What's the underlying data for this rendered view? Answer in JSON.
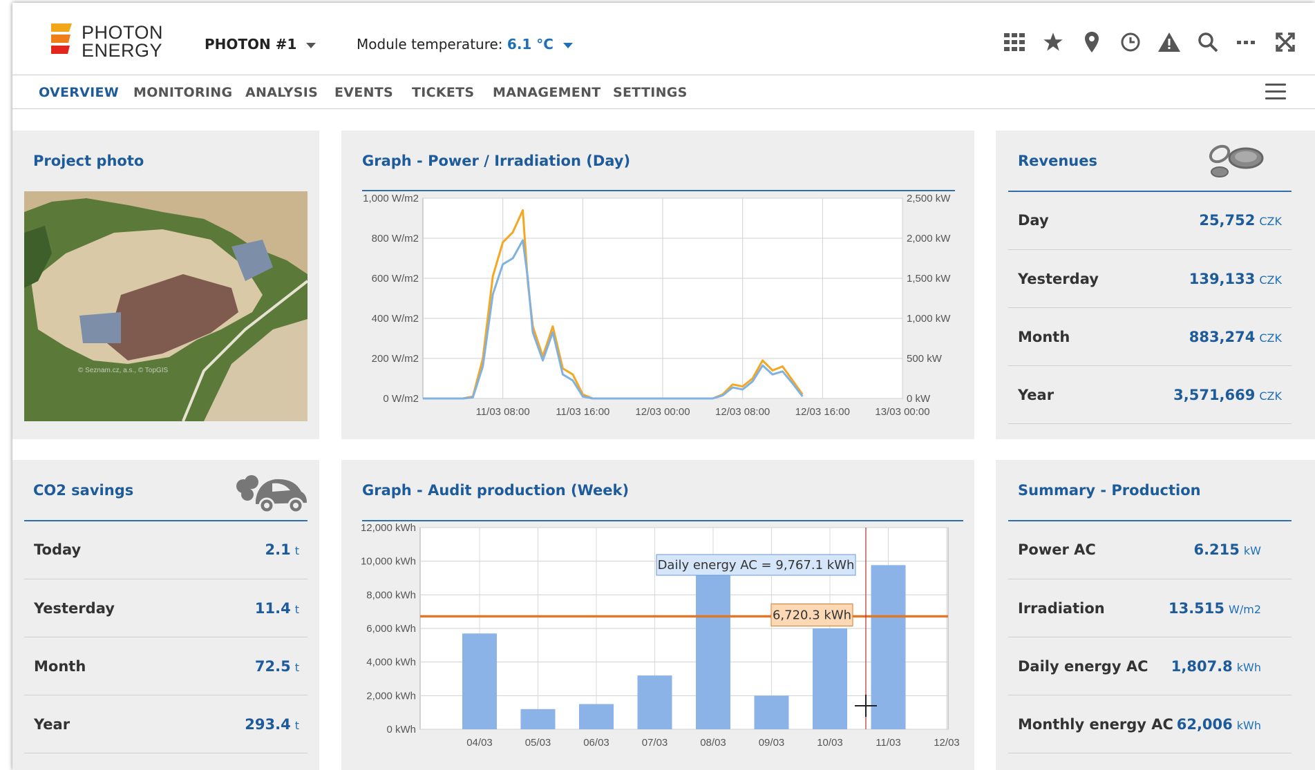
{
  "header": {
    "logo_line1": "PHOTON",
    "logo_line2": "ENERGY",
    "plant_selector": "PHOTON #1",
    "temperature_label": "Module temperature:",
    "temperature_value": "6.1 °C",
    "icons": [
      "grid-icon",
      "star-icon",
      "map-pin-icon",
      "clock-icon",
      "alert-icon",
      "search-icon",
      "more-icon",
      "fullscreen-icon"
    ]
  },
  "nav": {
    "tabs": [
      "OVERVIEW",
      "MONITORING",
      "ANALYSIS",
      "EVENTS",
      "TICKETS",
      "MANAGEMENT",
      "SETTINGS"
    ],
    "active": "OVERVIEW"
  },
  "project_photo": {
    "title": "Project photo",
    "watermark": "© Seznam.cz, a.s., © TopGIS"
  },
  "power_graph": {
    "title": "Graph - Power / Irradiation (Day)"
  },
  "revenues": {
    "title": "Revenues",
    "rows": [
      {
        "label": "Day",
        "value": "25,752",
        "unit": "CZK"
      },
      {
        "label": "Yesterday",
        "value": "139,133",
        "unit": "CZK"
      },
      {
        "label": "Month",
        "value": "883,274",
        "unit": "CZK"
      },
      {
        "label": "Year",
        "value": "3,571,669",
        "unit": "CZK"
      }
    ]
  },
  "co2": {
    "title": "CO2 savings",
    "rows": [
      {
        "label": "Today",
        "value": "2.1",
        "unit": "t"
      },
      {
        "label": "Yesterday",
        "value": "11.4",
        "unit": "t"
      },
      {
        "label": "Month",
        "value": "72.5",
        "unit": "t"
      },
      {
        "label": "Year",
        "value": "293.4",
        "unit": "t"
      }
    ]
  },
  "audit_graph": {
    "title": "Graph - Audit production (Week)",
    "tooltip": "Daily energy AC = 9,767.1 kWh",
    "line_label": "6,720.3 kWh"
  },
  "summary": {
    "title": "Summary - Production",
    "rows": [
      {
        "label": "Power AC",
        "value": "6.215",
        "unit": "kW"
      },
      {
        "label": "Irradiation",
        "value": "13.515",
        "unit": "W/m2"
      },
      {
        "label": "Daily energy AC",
        "value": "1,807.8",
        "unit": "kWh"
      },
      {
        "label": "Monthly energy AC",
        "value": "62,006",
        "unit": "kWh"
      }
    ]
  },
  "chart_data": [
    {
      "type": "line",
      "title": "Graph - Power / Irradiation (Day)",
      "x_ticks": [
        "11/03 08:00",
        "11/03 16:00",
        "12/03 00:00",
        "12/03 08:00",
        "12/03 16:00",
        "13/03 00:00"
      ],
      "y_left_ticks": [
        "0 W/m2",
        "200 W/m2",
        "400 W/m2",
        "600 W/m2",
        "800 W/m2",
        "1,000 W/m2"
      ],
      "y_right_ticks": [
        "0 kW",
        "500 kW",
        "1,000 kW",
        "1,500 kW",
        "2,000 kW",
        "2,500 kW"
      ],
      "ylim_left": [
        0,
        1000
      ],
      "ylim_right": [
        0,
        2500
      ],
      "x_hours": [
        0,
        4,
        5,
        6,
        7,
        8,
        9,
        10,
        10.5,
        11,
        12,
        13,
        14,
        15,
        16,
        17,
        18,
        29,
        30,
        31,
        32,
        33,
        34,
        35,
        36,
        37,
        38
      ],
      "series": [
        {
          "color": "#f5a623",
          "axis": "left",
          "values": [
            0,
            0,
            10,
            200,
            610,
            780,
            830,
            940,
            580,
            360,
            210,
            360,
            150,
            120,
            20,
            0,
            0,
            0,
            20,
            70,
            60,
            100,
            190,
            140,
            160,
            90,
            20
          ]
        },
        {
          "color": "#7fb2e0",
          "axis": "left",
          "values": [
            0,
            0,
            5,
            160,
            520,
            670,
            700,
            790,
            600,
            330,
            190,
            330,
            120,
            90,
            10,
            0,
            0,
            0,
            15,
            55,
            45,
            85,
            165,
            120,
            135,
            75,
            10
          ]
        }
      ],
      "grid": true
    },
    {
      "type": "bar",
      "title": "Graph - Audit production (Week)",
      "categories": [
        "04/03",
        "05/03",
        "06/03",
        "07/03",
        "08/03",
        "09/03",
        "10/03",
        "11/03",
        "12/03"
      ],
      "values": [
        5700,
        1200,
        1500,
        3200,
        9300,
        2000,
        6000,
        9767.1,
        0
      ],
      "y_ticks": [
        "0 kWh",
        "2,000 kWh",
        "4,000 kWh",
        "6,000 kWh",
        "8,000 kWh",
        "10,000 kWh",
        "12,000 kWh"
      ],
      "ylim": [
        0,
        12000
      ],
      "reference_line": 6720.3,
      "colors": {
        "bar": "#8bb3e8",
        "line": "#e0782a"
      },
      "grid": true
    }
  ]
}
